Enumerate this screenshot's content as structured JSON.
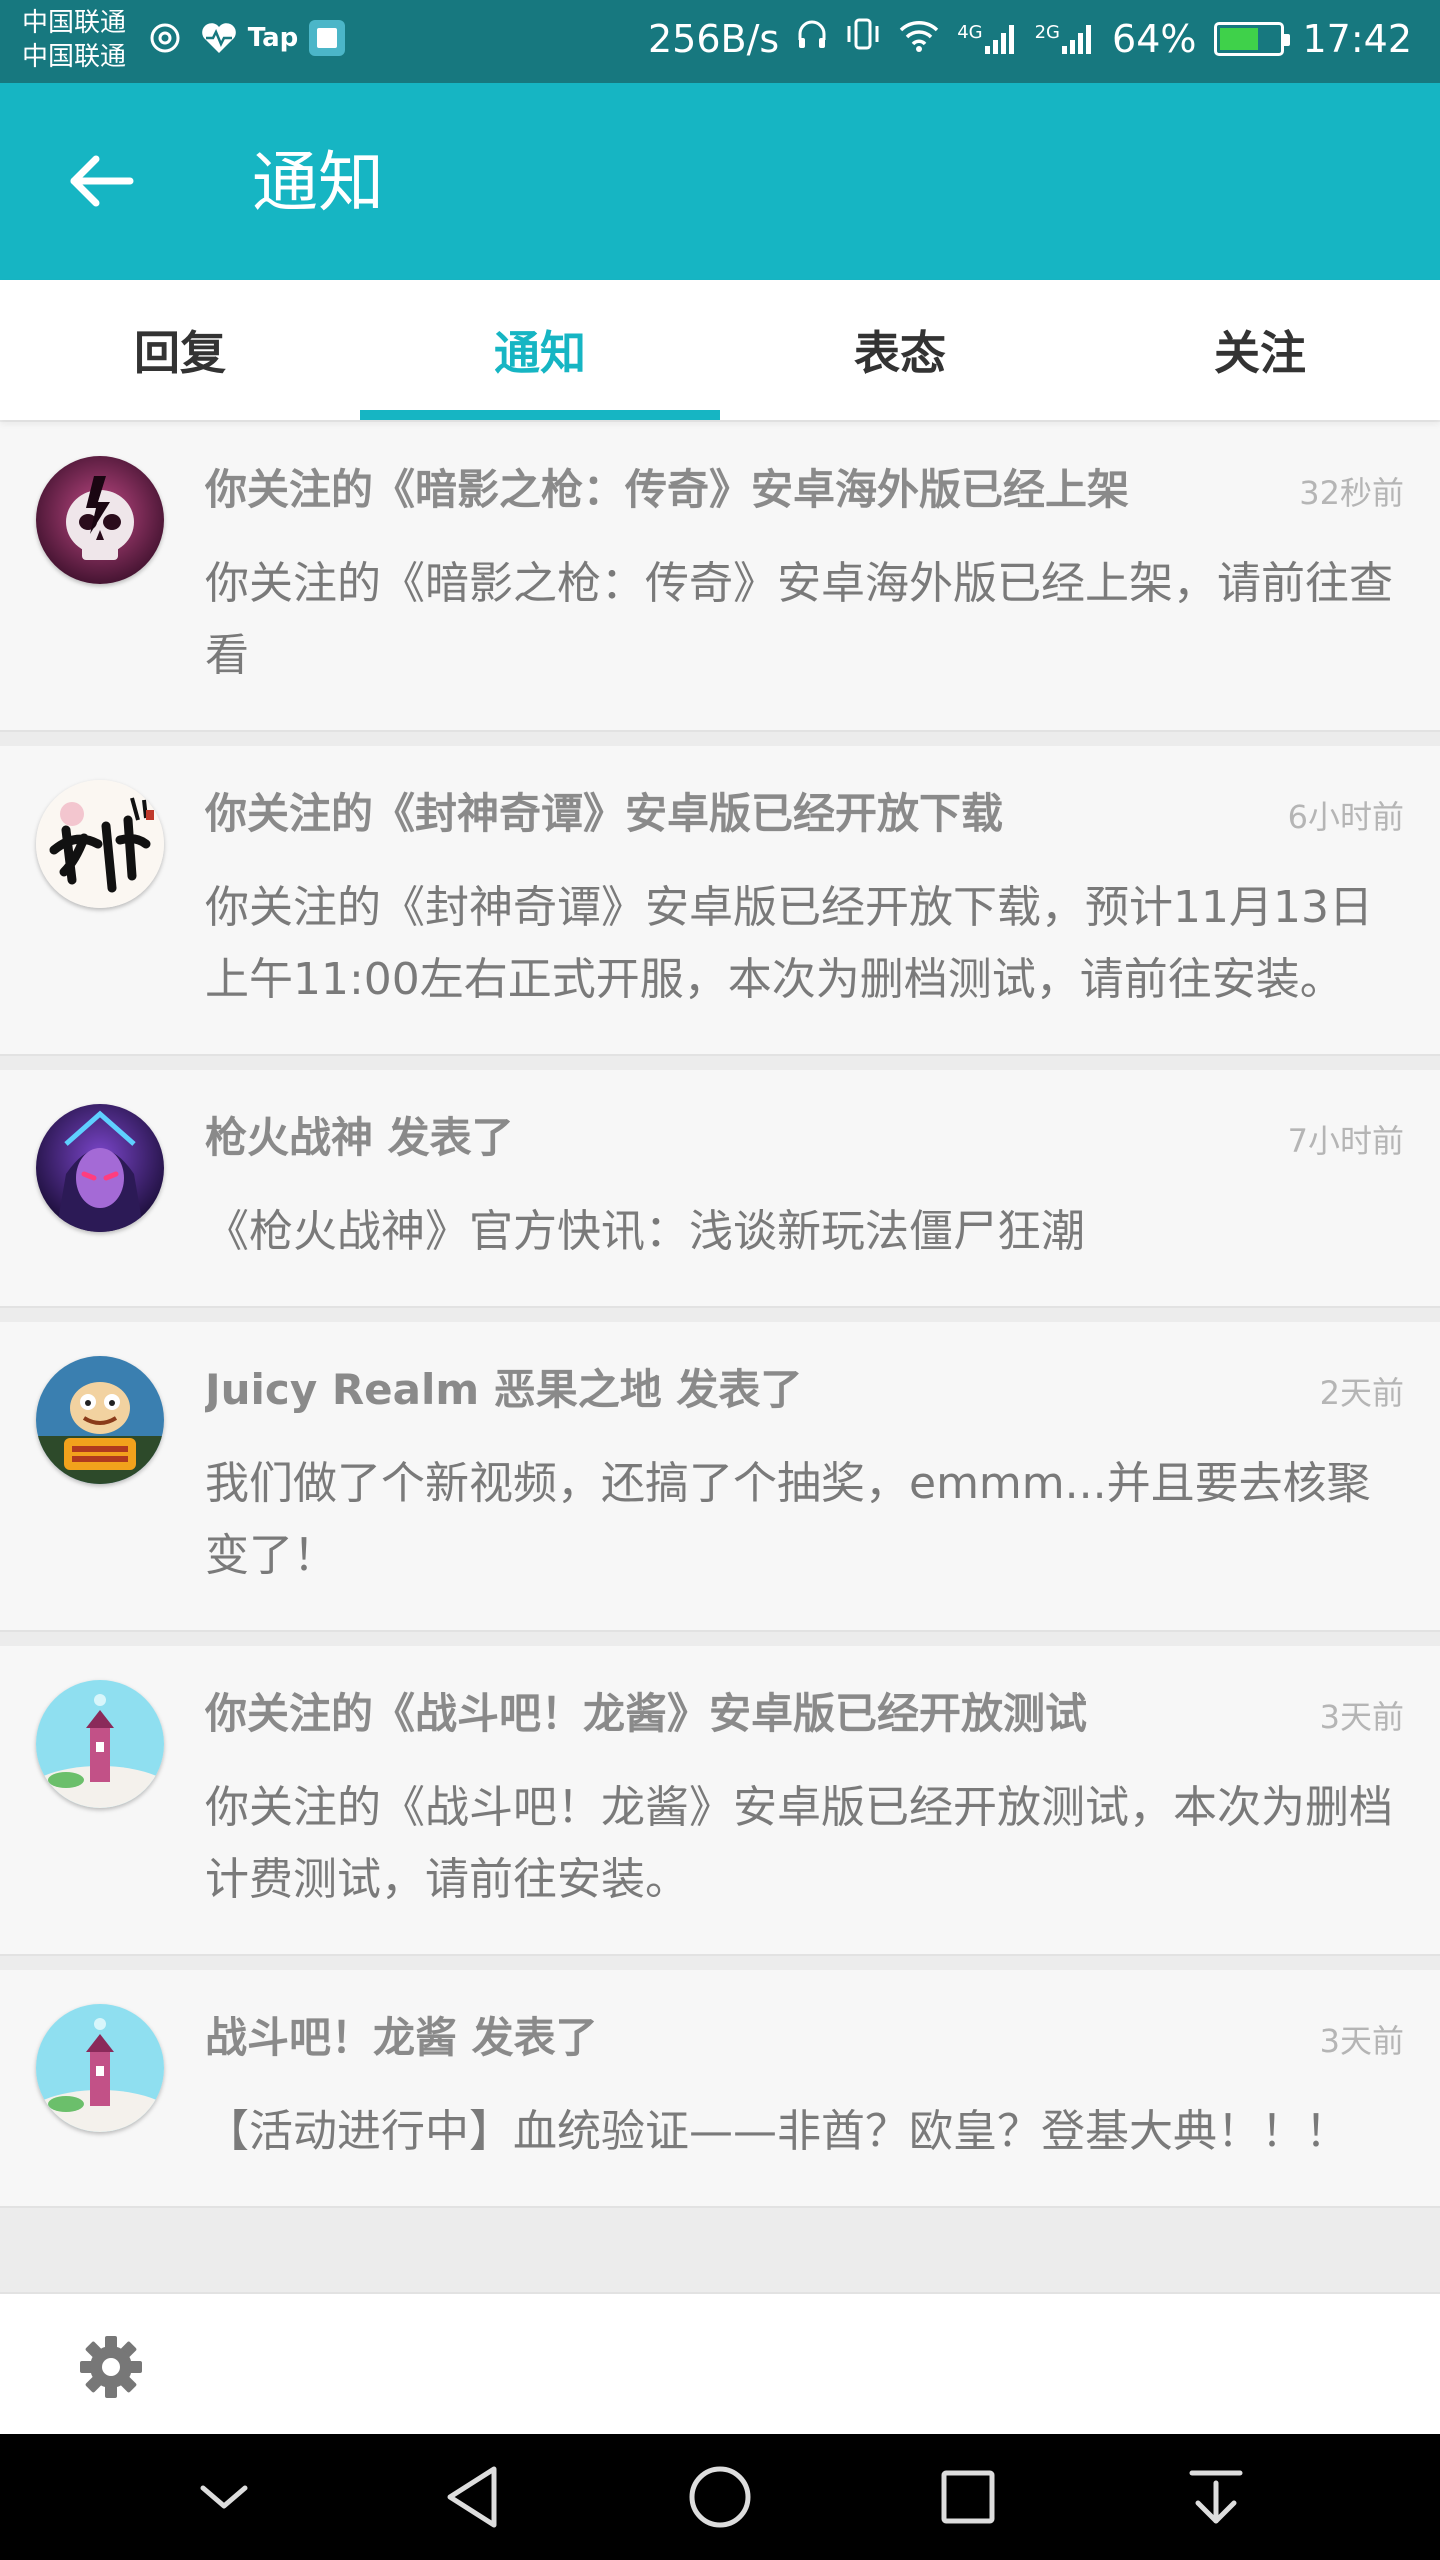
{
  "status_bar": {
    "carrier_1": "中国联通",
    "carrier_2": "中国联通",
    "tap_label": "Tap",
    "net_speed": "256B/s",
    "signal_1": "4G",
    "signal_2": "2G",
    "battery": "64%",
    "battery_level": 0.64,
    "time": "17:42"
  },
  "app_bar": {
    "back_icon": "arrow-left",
    "title": "通知"
  },
  "tabs": [
    {
      "label": "回复",
      "active": false
    },
    {
      "label": "通知",
      "active": true
    },
    {
      "label": "表态",
      "active": false
    },
    {
      "label": "关注",
      "active": false
    }
  ],
  "notifications": [
    {
      "title": "你关注的《暗影之枪：传奇》安卓海外版已经上架",
      "time": "32秒前",
      "body": "你关注的《暗影之枪：传奇》安卓海外版已经上架，请前往查看",
      "avatar": "skull-game-icon"
    },
    {
      "title": "你关注的《封神奇谭》安卓版已经开放下载",
      "time": "6小时前",
      "body": "你关注的《封神奇谭》安卓版已经开放下载，预计11月13日上午11:00左右正式开服，本次为删档测试，请前往安装。",
      "avatar": "calligraphy-game-icon"
    },
    {
      "title": "枪火战神 发表了",
      "time": "7小时前",
      "body": "《枪火战神》官方快讯：浅谈新玩法僵尸狂潮",
      "avatar": "purple-hero-game-icon"
    },
    {
      "title": "Juicy Realm 恶果之地 发表了",
      "time": "2天前",
      "body": "我们做了个新视频，还搞了个抽奖，emmm...并且要去核聚变了！",
      "avatar": "juicy-realm-game-icon"
    },
    {
      "title": "你关注的《战斗吧！龙酱》安卓版已经开放测试",
      "time": "3天前",
      "body": "你关注的《战斗吧！龙酱》安卓版已经开放测试，本次为删档计费测试，请前往安装。",
      "avatar": "tower-game-icon"
    },
    {
      "title": "战斗吧！龙酱 发表了",
      "time": "3天前",
      "body": "【活动进行中】血统验证——非酋？欧皇？登基大典！！！",
      "avatar": "tower-game-icon"
    }
  ],
  "bottom_bar": {
    "settings_icon": "gear"
  },
  "nav_bar": [
    "collapse-icon",
    "back-triangle-icon",
    "home-circle-icon",
    "recents-square-icon",
    "notification-pull-icon"
  ],
  "colors": {
    "accent": "#16b5c3",
    "status_bar": "#17787f"
  }
}
